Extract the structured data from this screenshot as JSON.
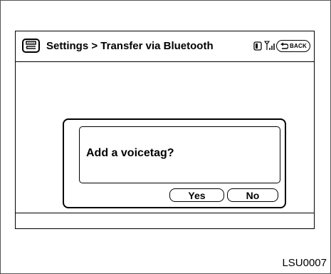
{
  "header": {
    "title": "Settings > Transfer via Bluetooth",
    "back_label": "BACK"
  },
  "icons": {
    "phone": "phone-menu-icon",
    "battery": "battery-icon",
    "signal": "signal-strength-icon",
    "back": "back-arrow-icon"
  },
  "dialog": {
    "message": "Add a voicetag?",
    "yes_label": "Yes",
    "no_label": "No"
  },
  "figure_code": "LSU0007"
}
